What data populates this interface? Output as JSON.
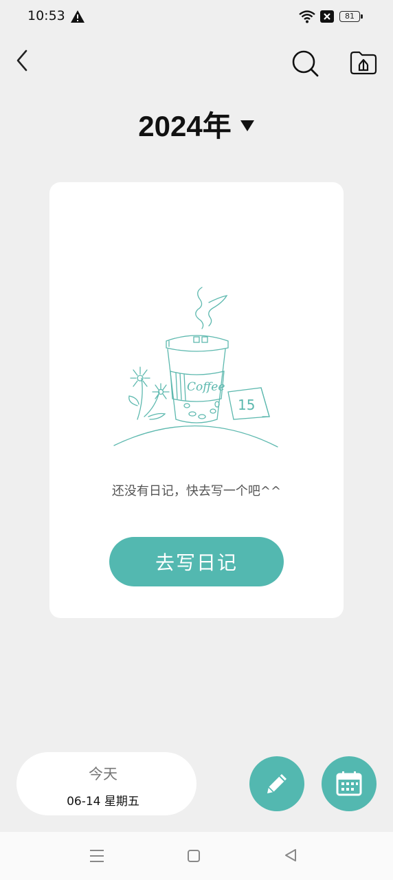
{
  "status_bar": {
    "time": "10:53",
    "battery": "81",
    "icons": [
      "warning-icon",
      "wifi-icon",
      "x-icon",
      "battery-icon"
    ]
  },
  "header": {
    "year_label": "2024年",
    "icons": [
      "back-icon",
      "search-icon",
      "cloud-upload-icon",
      "caret-down-icon"
    ]
  },
  "card": {
    "illustration": "coffee-cup-illustration",
    "cup_text": "Coffee",
    "calendar_day": "15",
    "empty_message": "还没有日记，快去写一个吧^^",
    "write_button_label": "去写日记"
  },
  "bottom": {
    "today_label": "今天",
    "date_text": "06-14 星期五",
    "fab_icons": [
      "pencil-icon",
      "calendar-icon"
    ]
  },
  "nav": {
    "icons": [
      "menu-icon",
      "home-icon",
      "back-triangle-icon"
    ]
  },
  "colors": {
    "accent": "#53b8b0",
    "background": "#efefef",
    "card": "#ffffff"
  }
}
